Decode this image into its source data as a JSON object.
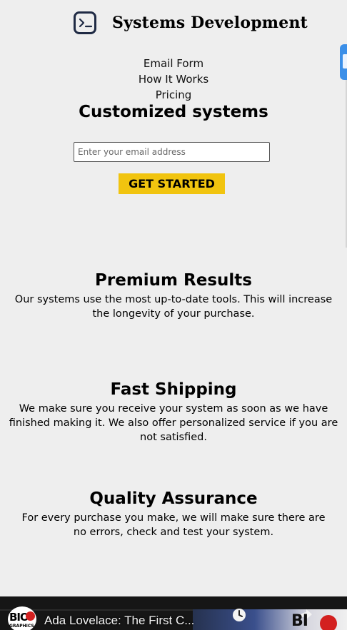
{
  "header": {
    "brand": "Systems Development",
    "logo_icon": "terminal-icon"
  },
  "nav": {
    "items": [
      "Email Form",
      "How It Works",
      "Pricing"
    ]
  },
  "hero": {
    "title": "Customized systems",
    "email_placeholder": "Enter your email address",
    "cta_label": "GET STARTED"
  },
  "features": [
    {
      "title": "Premium Results",
      "text": "Our systems use the most up-to-date tools. This will increase the longevity of your purchase."
    },
    {
      "title": "Fast Shipping",
      "text": "We make sure you receive your system as soon as we have finished making it. We also offer personalized service if you are not satisfied."
    },
    {
      "title": "Quality Assurance",
      "text": "For every purchase you make, we will make sure there are no errors, check and test your system."
    }
  ],
  "video": {
    "title": "Ada Lovelace: The First C...",
    "channel_logo_text": "BIO",
    "channel_logo_sub": "GRAPHICS"
  },
  "colors": {
    "background": "#eeeeee",
    "cta": "#f1c40f",
    "logo_border": "#1f2a44",
    "side_tab": "#3b8fe8"
  }
}
